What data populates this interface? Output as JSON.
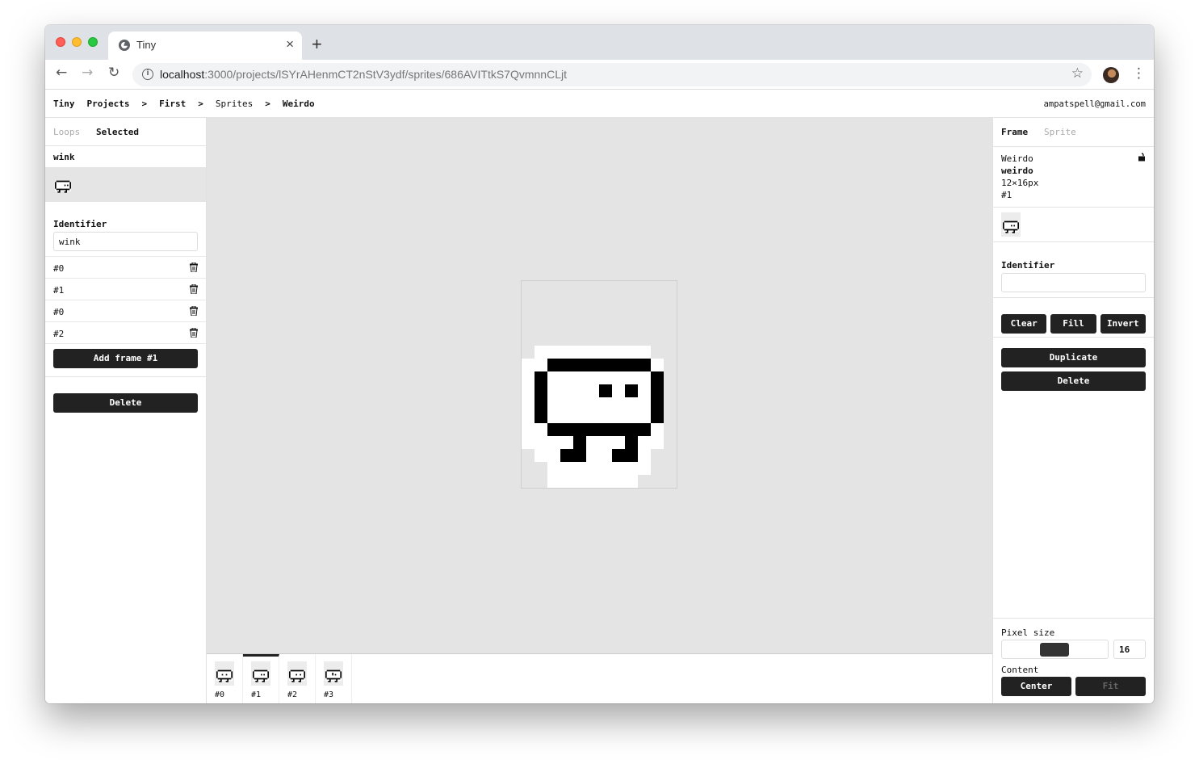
{
  "browser": {
    "tab_title": "Tiny",
    "url_host": "localhost",
    "url_path": ":3000/projects/lSYrAHenmCT2nStV3ydf/sprites/686AVITtkS7QvmnnCLjt"
  },
  "breadcrumb": {
    "app": "Tiny",
    "projects": "Projects",
    "project": "First",
    "sprites": "Sprites",
    "sprite": "Weirdo",
    "separator": ">"
  },
  "user_email": "ampatspell@gmail.com",
  "left": {
    "tabs": [
      "Loops",
      "Selected"
    ],
    "loop_name": "wink",
    "identifier_label": "Identifier",
    "identifier_value": "wink",
    "frames": [
      {
        "label": "#0"
      },
      {
        "label": "#1"
      },
      {
        "label": "#0"
      },
      {
        "label": "#2"
      }
    ],
    "add_frame_label": "Add frame #1",
    "delete_label": "Delete"
  },
  "strip": {
    "frames": [
      "#0",
      "#1",
      "#2",
      "#3"
    ],
    "active_index": 1
  },
  "right": {
    "tabs": [
      "Frame",
      "Sprite"
    ],
    "sprite_title": "Weirdo",
    "sprite_identifier": "weirdo",
    "sprite_size": "12×16px",
    "frame_index": "#1",
    "identifier_label": "Identifier",
    "identifier_value": "",
    "clear_label": "Clear",
    "fill_label": "Fill",
    "invert_label": "Invert",
    "duplicate_label": "Duplicate",
    "delete_label": "Delete",
    "pixel_size_label": "Pixel size",
    "pixel_size_value": "16",
    "content_label": "Content",
    "center_label": "Center",
    "fit_label": "Fit"
  },
  "colors": {
    "button_bg": "#222222",
    "canvas_bg": "#e4e4e4"
  }
}
